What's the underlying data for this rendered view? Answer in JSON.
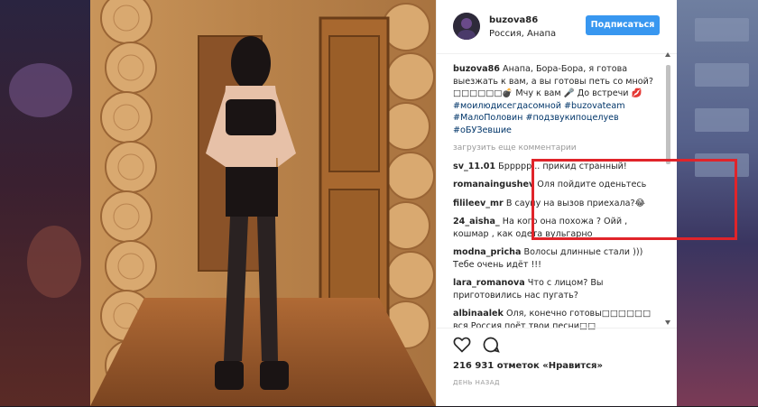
{
  "post": {
    "username": "buzova86",
    "location": "Россия, Анапа",
    "follow_label": "Подписаться"
  },
  "caption": {
    "username": "buzova86",
    "text": "Анапа, Бора-Бора, я готова выезжать к вам, а вы готовы петь со мной?□□□□□□💣 Мчу к вам 🎤 До встречи 💋 ",
    "tags": "#моилюдисегдасомной #buzovateam #МалоПоловин #подзвукипоцелуев #оБУЗевшие"
  },
  "load_more_label": "загрузить еще комментарии",
  "comments": [
    {
      "username": "sv_11.01",
      "text": "Бррррр... прикид странный!"
    },
    {
      "username": "romanaingushev",
      "text": "Оля пойдите оденьтесь"
    },
    {
      "username": "filileev_mr",
      "text": "В сауну на вызов приехала?😂"
    },
    {
      "username": "24_aisha_",
      "text": "На кого она похожа ? Ойй , кошмар , как одета вульгарно"
    },
    {
      "username": "modna_pricha",
      "text": "Волосы длинные стали ))) Тебе очень идёт !!!"
    },
    {
      "username": "lara_romanova",
      "text": "Что с лицом? Вы приготовились нас пугать?"
    },
    {
      "username": "albinaalek",
      "text": "Оля, конечно готовы□□□□□□ вся Россия поёт твои песни□□"
    }
  ],
  "likes_label": "216 931 отметок «Нравится»",
  "time_label": "ДЕНЬ НАЗАД",
  "icons": {
    "like": "heart-icon",
    "comment": "comment-icon"
  },
  "colors": {
    "follow": "#3897f0",
    "highlight": "#e0242a",
    "hashtag": "#003569"
  }
}
